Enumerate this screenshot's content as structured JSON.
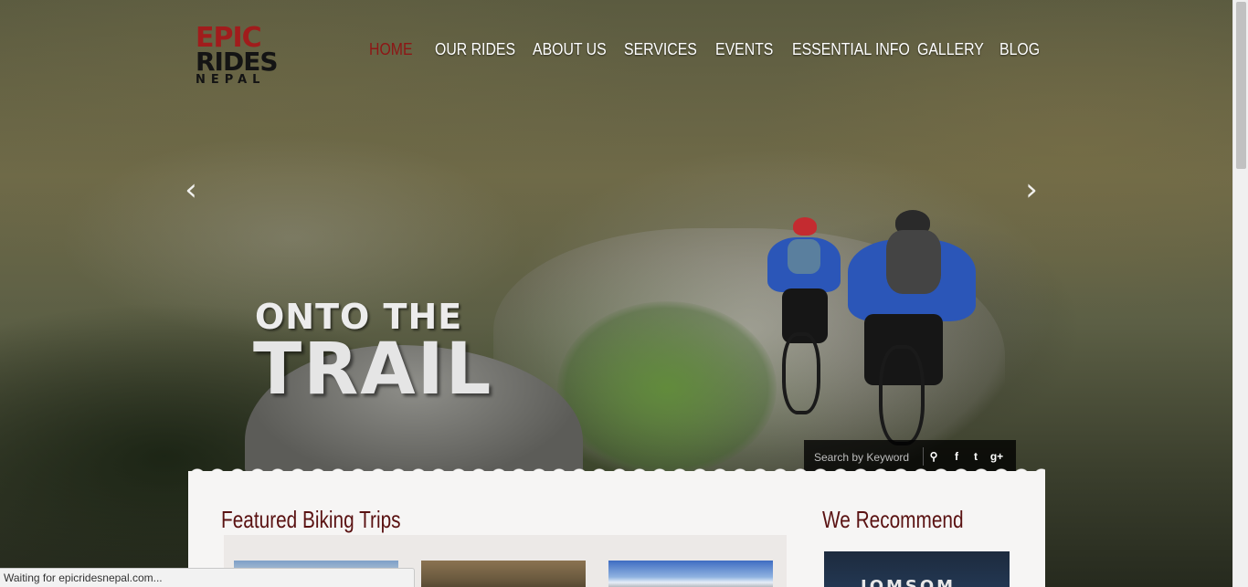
{
  "site": {
    "logo": {
      "line1": "EPIC",
      "line2": "RIDES",
      "line3": "NEPAL"
    }
  },
  "nav": {
    "items": [
      {
        "label": "HOME",
        "active": true
      },
      {
        "label": "OUR RIDES"
      },
      {
        "label": "ABOUT US"
      },
      {
        "label": "SERVICES"
      },
      {
        "label": "EVENTS"
      },
      {
        "label": "ESSENTIAL INFO"
      },
      {
        "label": "GALLERY"
      },
      {
        "label": "BLOG"
      }
    ]
  },
  "slider": {
    "caption_top": "ONTO THE",
    "caption_main": "TRAIL",
    "prev_icon": "chevron-left-icon",
    "next_icon": "chevron-right-icon"
  },
  "search": {
    "placeholder": "Search by Keyword",
    "search_icon": "search-icon",
    "facebook_icon": "facebook-icon",
    "twitter_icon": "twitter-icon",
    "googleplus_icon": "google-plus-icon",
    "icon_glyphs": {
      "search": "⚲",
      "facebook": "f",
      "twitter": "t",
      "googleplus": "g+"
    }
  },
  "content": {
    "featured_title": "Featured Biking Trips",
    "recommend_title": "We Recommend",
    "recommend_ad_text": "JOMSOM"
  },
  "browser": {
    "status_text": "Waiting for epicridesnepal.com..."
  },
  "colors": {
    "accent": "#8e1515",
    "heading": "#5a1212",
    "panel": "#f6f5f4"
  }
}
